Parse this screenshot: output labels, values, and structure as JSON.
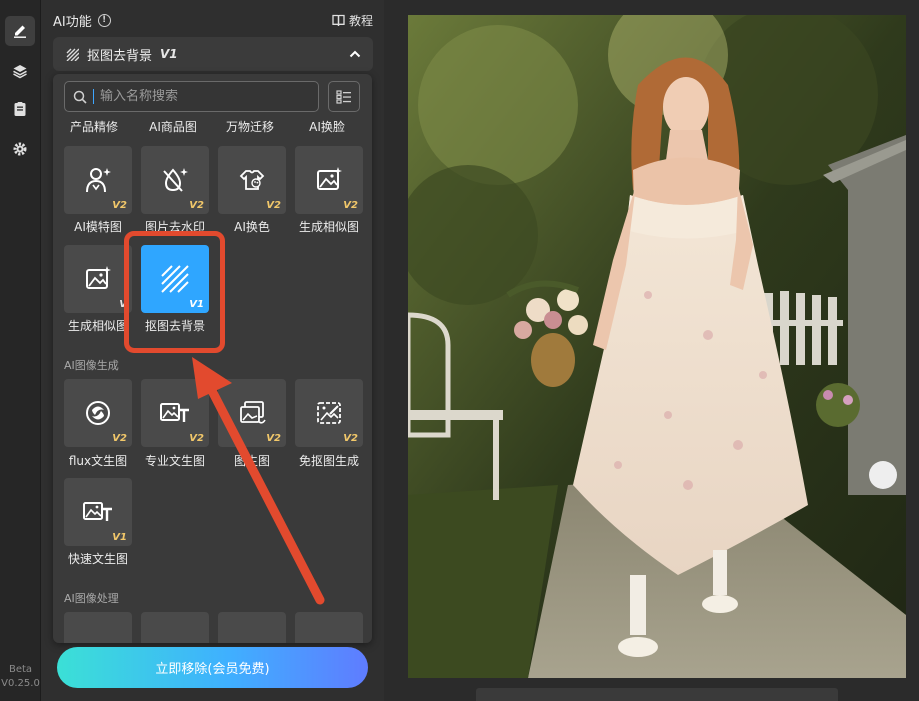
{
  "rail": {
    "beta_label": "Beta",
    "version_label": "V0.25.0"
  },
  "panel": {
    "title": "AI功能",
    "tutorial_label": "教程",
    "section_label": "抠图去背景",
    "section_version": "V1"
  },
  "search": {
    "placeholder": "输入名称搜索"
  },
  "top_row_labels": [
    "产品精修",
    "AI商品图",
    "万物迁移",
    "AI换脸"
  ],
  "tools_row1": [
    {
      "label": "AI模特图",
      "version": "V2",
      "icon": "model-icon"
    },
    {
      "label": "图片去水印",
      "version": "V2",
      "icon": "watermark-remove-icon"
    },
    {
      "label": "AI换色",
      "version": "V2",
      "icon": "color-change-icon"
    },
    {
      "label": "生成相似图",
      "version": "V2",
      "icon": "similar-image-icon"
    }
  ],
  "tools_row2": [
    {
      "label": "生成相似图",
      "version": "V",
      "icon": "similar-image-icon"
    },
    {
      "label": "抠图去背景",
      "version": "V1",
      "icon": "cutout-icon",
      "selected": true
    }
  ],
  "category_generation": "AI图像生成",
  "tools_gen_row1": [
    {
      "label": "flux文生图",
      "version": "V2",
      "icon": "flux-icon"
    },
    {
      "label": "专业文生图",
      "version": "V2",
      "icon": "text-to-image-icon"
    },
    {
      "label": "图生图",
      "version": "V2",
      "icon": "image-to-image-icon"
    },
    {
      "label": "免抠图生成",
      "version": "V2",
      "icon": "no-cutout-icon"
    }
  ],
  "tools_gen_row2": [
    {
      "label": "快速文生图",
      "version": "V1",
      "icon": "fast-text-to-image-icon"
    }
  ],
  "category_processing": "AI图像处理",
  "cta_label": "立即移除(会员免费)",
  "colors": {
    "accent": "#2fa6ff",
    "highlight_box": "#e24a2e",
    "version_badge": "#f2c86a"
  }
}
